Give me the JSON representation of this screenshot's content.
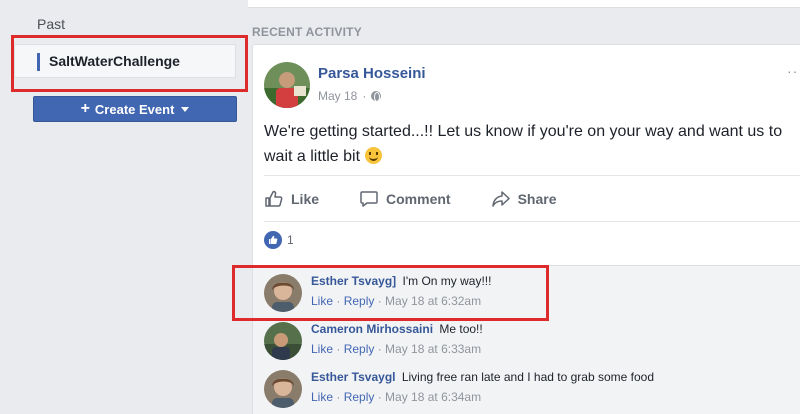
{
  "sidebar": {
    "past_label": "Past",
    "event_name": "SaltWaterChallenge",
    "create_event_label": "Create Event"
  },
  "feed": {
    "section_title": "RECENT ACTIVITY",
    "post": {
      "author": "Parsa Hosseini",
      "date": "May 18",
      "separator": "·",
      "text": "We're getting started...!! Let us know if you're on your way and want us to wait a little bit",
      "more_label": "···",
      "actions": {
        "like": "Like",
        "comment": "Comment",
        "share": "Share"
      },
      "reaction_count": "1"
    },
    "comments": [
      {
        "author": "Esther Tsvayg] ",
        "text": "I'm On my way!!!",
        "like": "Like",
        "reply": "Reply",
        "time": "May 18 at 6:32am"
      },
      {
        "author": "Cameron Mirhossaini",
        "text": "Me too!!",
        "like": "Like",
        "reply": "Reply",
        "time": "May 18 at 6:33am"
      },
      {
        "author": "Esther Tsvaygl",
        "text": "Living free ran late and I had to grab some food",
        "like": "Like",
        "reply": "Reply",
        "time": "May 18 at 6:34am"
      }
    ],
    "dismiss_icon": "×"
  },
  "colors": {
    "brand": "#4267b2",
    "link": "#365899",
    "highlight": "#dd2a2a",
    "page_bg": "#e9ebee"
  }
}
